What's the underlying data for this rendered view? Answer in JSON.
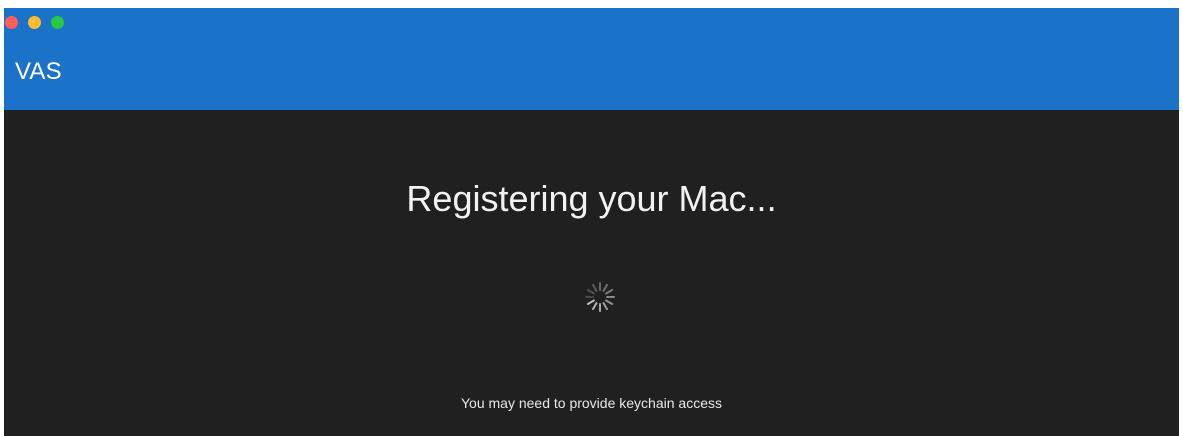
{
  "window": {
    "app_title": "VAS",
    "controls": [
      "close",
      "minimize",
      "zoom"
    ]
  },
  "main": {
    "heading": "Registering your Mac...",
    "spinner": "activity-spinner-icon",
    "note": "You may need to provide keychain access"
  },
  "colors": {
    "titlebar": "#1a73c8",
    "content_bg": "#202020",
    "close": "#fe5f57",
    "minimize": "#febc2e",
    "zoom": "#28c840"
  }
}
